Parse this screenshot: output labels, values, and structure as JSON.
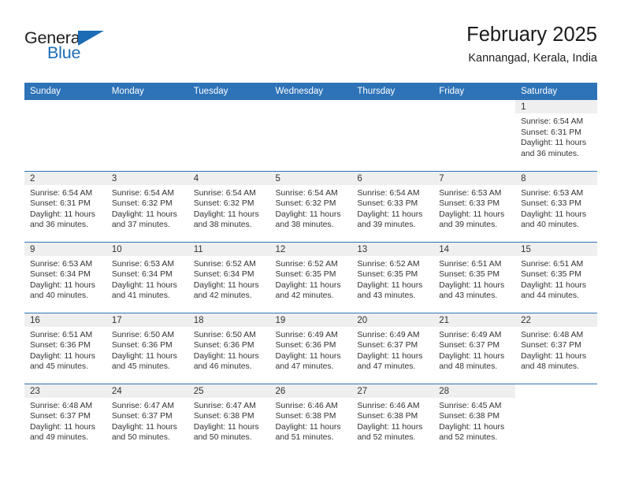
{
  "brand": {
    "name_part1": "General",
    "name_part2": "Blue",
    "accent_color": "#1b6cb5"
  },
  "header": {
    "title": "February 2025",
    "subtitle": "Kannangad, Kerala, India"
  },
  "calendar": {
    "header_color": "#2e73b8",
    "daynum_band_color": "#efefef",
    "weekday_headers": [
      "Sunday",
      "Monday",
      "Tuesday",
      "Wednesday",
      "Thursday",
      "Friday",
      "Saturday"
    ],
    "weeks": [
      [
        {
          "day": "",
          "blank": true
        },
        {
          "day": "",
          "blank": true
        },
        {
          "day": "",
          "blank": true
        },
        {
          "day": "",
          "blank": true
        },
        {
          "day": "",
          "blank": true
        },
        {
          "day": "",
          "blank": true
        },
        {
          "day": "1",
          "sunrise": "Sunrise: 6:54 AM",
          "sunset": "Sunset: 6:31 PM",
          "daylight1": "Daylight: 11 hours",
          "daylight2": "and 36 minutes."
        }
      ],
      [
        {
          "day": "2",
          "sunrise": "Sunrise: 6:54 AM",
          "sunset": "Sunset: 6:31 PM",
          "daylight1": "Daylight: 11 hours",
          "daylight2": "and 36 minutes."
        },
        {
          "day": "3",
          "sunrise": "Sunrise: 6:54 AM",
          "sunset": "Sunset: 6:32 PM",
          "daylight1": "Daylight: 11 hours",
          "daylight2": "and 37 minutes."
        },
        {
          "day": "4",
          "sunrise": "Sunrise: 6:54 AM",
          "sunset": "Sunset: 6:32 PM",
          "daylight1": "Daylight: 11 hours",
          "daylight2": "and 38 minutes."
        },
        {
          "day": "5",
          "sunrise": "Sunrise: 6:54 AM",
          "sunset": "Sunset: 6:32 PM",
          "daylight1": "Daylight: 11 hours",
          "daylight2": "and 38 minutes."
        },
        {
          "day": "6",
          "sunrise": "Sunrise: 6:54 AM",
          "sunset": "Sunset: 6:33 PM",
          "daylight1": "Daylight: 11 hours",
          "daylight2": "and 39 minutes."
        },
        {
          "day": "7",
          "sunrise": "Sunrise: 6:53 AM",
          "sunset": "Sunset: 6:33 PM",
          "daylight1": "Daylight: 11 hours",
          "daylight2": "and 39 minutes."
        },
        {
          "day": "8",
          "sunrise": "Sunrise: 6:53 AM",
          "sunset": "Sunset: 6:33 PM",
          "daylight1": "Daylight: 11 hours",
          "daylight2": "and 40 minutes."
        }
      ],
      [
        {
          "day": "9",
          "sunrise": "Sunrise: 6:53 AM",
          "sunset": "Sunset: 6:34 PM",
          "daylight1": "Daylight: 11 hours",
          "daylight2": "and 40 minutes."
        },
        {
          "day": "10",
          "sunrise": "Sunrise: 6:53 AM",
          "sunset": "Sunset: 6:34 PM",
          "daylight1": "Daylight: 11 hours",
          "daylight2": "and 41 minutes."
        },
        {
          "day": "11",
          "sunrise": "Sunrise: 6:52 AM",
          "sunset": "Sunset: 6:34 PM",
          "daylight1": "Daylight: 11 hours",
          "daylight2": "and 42 minutes."
        },
        {
          "day": "12",
          "sunrise": "Sunrise: 6:52 AM",
          "sunset": "Sunset: 6:35 PM",
          "daylight1": "Daylight: 11 hours",
          "daylight2": "and 42 minutes."
        },
        {
          "day": "13",
          "sunrise": "Sunrise: 6:52 AM",
          "sunset": "Sunset: 6:35 PM",
          "daylight1": "Daylight: 11 hours",
          "daylight2": "and 43 minutes."
        },
        {
          "day": "14",
          "sunrise": "Sunrise: 6:51 AM",
          "sunset": "Sunset: 6:35 PM",
          "daylight1": "Daylight: 11 hours",
          "daylight2": "and 43 minutes."
        },
        {
          "day": "15",
          "sunrise": "Sunrise: 6:51 AM",
          "sunset": "Sunset: 6:35 PM",
          "daylight1": "Daylight: 11 hours",
          "daylight2": "and 44 minutes."
        }
      ],
      [
        {
          "day": "16",
          "sunrise": "Sunrise: 6:51 AM",
          "sunset": "Sunset: 6:36 PM",
          "daylight1": "Daylight: 11 hours",
          "daylight2": "and 45 minutes."
        },
        {
          "day": "17",
          "sunrise": "Sunrise: 6:50 AM",
          "sunset": "Sunset: 6:36 PM",
          "daylight1": "Daylight: 11 hours",
          "daylight2": "and 45 minutes."
        },
        {
          "day": "18",
          "sunrise": "Sunrise: 6:50 AM",
          "sunset": "Sunset: 6:36 PM",
          "daylight1": "Daylight: 11 hours",
          "daylight2": "and 46 minutes."
        },
        {
          "day": "19",
          "sunrise": "Sunrise: 6:49 AM",
          "sunset": "Sunset: 6:36 PM",
          "daylight1": "Daylight: 11 hours",
          "daylight2": "and 47 minutes."
        },
        {
          "day": "20",
          "sunrise": "Sunrise: 6:49 AM",
          "sunset": "Sunset: 6:37 PM",
          "daylight1": "Daylight: 11 hours",
          "daylight2": "and 47 minutes."
        },
        {
          "day": "21",
          "sunrise": "Sunrise: 6:49 AM",
          "sunset": "Sunset: 6:37 PM",
          "daylight1": "Daylight: 11 hours",
          "daylight2": "and 48 minutes."
        },
        {
          "day": "22",
          "sunrise": "Sunrise: 6:48 AM",
          "sunset": "Sunset: 6:37 PM",
          "daylight1": "Daylight: 11 hours",
          "daylight2": "and 48 minutes."
        }
      ],
      [
        {
          "day": "23",
          "sunrise": "Sunrise: 6:48 AM",
          "sunset": "Sunset: 6:37 PM",
          "daylight1": "Daylight: 11 hours",
          "daylight2": "and 49 minutes."
        },
        {
          "day": "24",
          "sunrise": "Sunrise: 6:47 AM",
          "sunset": "Sunset: 6:37 PM",
          "daylight1": "Daylight: 11 hours",
          "daylight2": "and 50 minutes."
        },
        {
          "day": "25",
          "sunrise": "Sunrise: 6:47 AM",
          "sunset": "Sunset: 6:38 PM",
          "daylight1": "Daylight: 11 hours",
          "daylight2": "and 50 minutes."
        },
        {
          "day": "26",
          "sunrise": "Sunrise: 6:46 AM",
          "sunset": "Sunset: 6:38 PM",
          "daylight1": "Daylight: 11 hours",
          "daylight2": "and 51 minutes."
        },
        {
          "day": "27",
          "sunrise": "Sunrise: 6:46 AM",
          "sunset": "Sunset: 6:38 PM",
          "daylight1": "Daylight: 11 hours",
          "daylight2": "and 52 minutes."
        },
        {
          "day": "28",
          "sunrise": "Sunrise: 6:45 AM",
          "sunset": "Sunset: 6:38 PM",
          "daylight1": "Daylight: 11 hours",
          "daylight2": "and 52 minutes."
        },
        {
          "day": "",
          "blank": true
        }
      ]
    ]
  }
}
